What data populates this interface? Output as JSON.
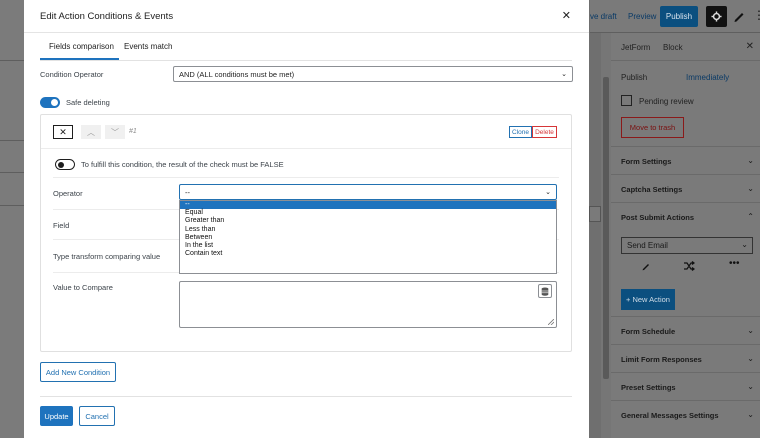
{
  "editor": {
    "save_draft": "ve draft",
    "preview": "Preview",
    "publish": "Publish",
    "sidebar": {
      "tab_form": "JetForm",
      "tab_block": "Block",
      "close": "✕",
      "publish_label": "Publish",
      "publish_value": "Immediately",
      "pending_review": "Pending review",
      "move_to_trash": "Move to trash",
      "panels": [
        "Form Settings",
        "Captcha Settings",
        "Post Submit Actions",
        "Form Schedule",
        "Limit Form Responses",
        "Preset Settings",
        "General Messages Settings"
      ],
      "send_email": "Send Email",
      "new_action": "+ New Action"
    }
  },
  "modal": {
    "title": "Edit Action Conditions & Events",
    "close": "✕",
    "tabs": [
      "Fields comparison",
      "Events match"
    ],
    "condition_operator_label": "Condition Operator",
    "condition_operator_value": "AND (ALL conditions must be met)",
    "safe_deleting_label": "Safe deleting",
    "condition": {
      "number": "#1",
      "clone": "Clone",
      "delete": "Delete",
      "fulfill_text": "To fulfill this condition, the result of the check must be FALSE",
      "operator_label": "Operator",
      "operator_value": "--",
      "field_label": "Field",
      "transform_label": "Type transform comparing value",
      "value_label": "Value to Compare",
      "operator_options": [
        "--",
        "Equal",
        "Greater than",
        "Less than",
        "Between",
        "In the list",
        "Contain text"
      ]
    },
    "add_condition": "Add New Condition",
    "update": "Update",
    "cancel": "Cancel"
  },
  "colors": {
    "accent": "#1e73be",
    "danger": "#d63638"
  }
}
